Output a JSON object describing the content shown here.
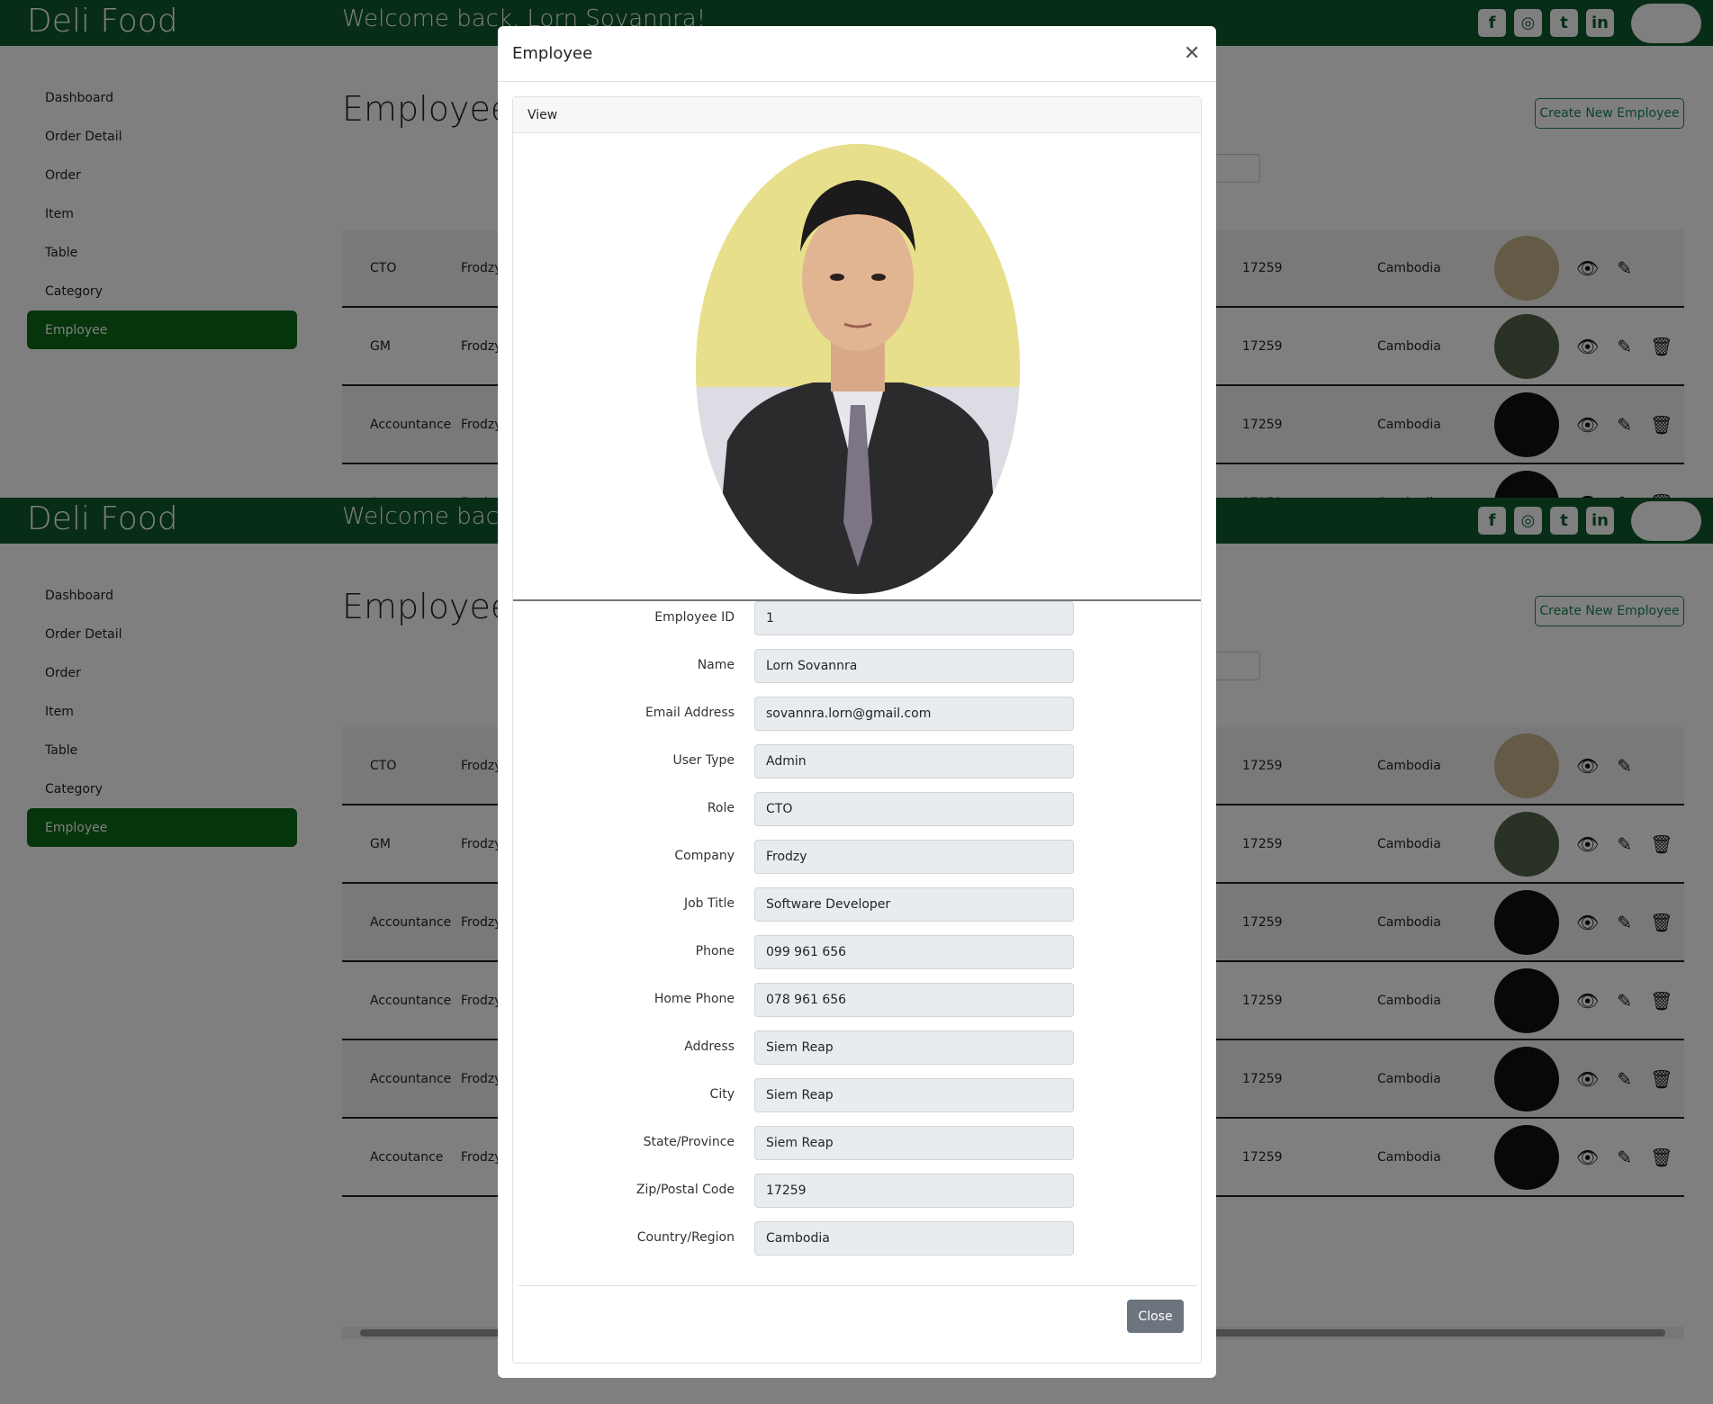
{
  "app": {
    "brand": "Deli Food",
    "welcome": "Welcome back, Lorn Sovannra!",
    "socials": [
      {
        "icon": "facebook-icon",
        "glyph": "f"
      },
      {
        "icon": "instagram-icon",
        "glyph": "◎"
      },
      {
        "icon": "twitter-icon",
        "glyph": "t"
      },
      {
        "icon": "linkedin-icon",
        "glyph": "in"
      }
    ]
  },
  "sidebar": {
    "items": [
      {
        "label": "Dashboard",
        "active": false
      },
      {
        "label": "Order Detail",
        "active": false
      },
      {
        "label": "Order",
        "active": false
      },
      {
        "label": "Item",
        "active": false
      },
      {
        "label": "Table",
        "active": false
      },
      {
        "label": "Category",
        "active": false
      },
      {
        "label": "Employee",
        "active": true
      }
    ]
  },
  "main": {
    "title": "Employee",
    "create_label": "Create New Employee",
    "rows": [
      {
        "role": "CTO",
        "company": "Frodzy",
        "zip": "17259",
        "country": "Cambodia",
        "photo": "photo",
        "delete": false
      },
      {
        "role": "GM",
        "company": "Frodzy",
        "zip": "17259",
        "country": "Cambodia",
        "photo": "photo-olive",
        "delete": true
      },
      {
        "role": "Accountance",
        "company": "Frodzy",
        "zip": "17259",
        "country": "Cambodia",
        "photo": "placeholder",
        "delete": true
      },
      {
        "role": "Accountance",
        "company": "Frodzy",
        "zip": "17259",
        "country": "Cambodia",
        "photo": "placeholder",
        "delete": true
      },
      {
        "role": "Accountance",
        "company": "Frodzy",
        "zip": "17259",
        "country": "Cambodia",
        "photo": "placeholder",
        "delete": true
      },
      {
        "role": "Accoutance",
        "company": "Frodzy",
        "zip": "17259",
        "country": "Cambodia",
        "photo": "placeholder",
        "delete": true
      }
    ]
  },
  "modal": {
    "title": "Employee",
    "card_header": "View",
    "close_label": "Close",
    "fields": [
      {
        "label": "Employee ID",
        "value": "1"
      },
      {
        "label": "Name",
        "value": "Lorn Sovannra"
      },
      {
        "label": "Email Address",
        "value": "sovannra.lorn@gmail.com"
      },
      {
        "label": "User Type",
        "value": "Admin"
      },
      {
        "label": "Role",
        "value": "CTO"
      },
      {
        "label": "Company",
        "value": "Frodzy"
      },
      {
        "label": "Job Title",
        "value": "Software Developer"
      },
      {
        "label": "Phone",
        "value": "099 961 656"
      },
      {
        "label": "Home Phone",
        "value": "078 961 656"
      },
      {
        "label": "Address",
        "value": "Siem Reap"
      },
      {
        "label": "City",
        "value": "Siem Reap"
      },
      {
        "label": "State/Province",
        "value": "Siem Reap"
      },
      {
        "label": "Zip/Postal Code",
        "value": "17259"
      },
      {
        "label": "Country/Region",
        "value": "Cambodia"
      }
    ]
  },
  "colors": {
    "topbar": "#0f5a2c",
    "sidebar_active": "#0d6b18",
    "accent": "#198754",
    "close_button": "#6c757d"
  }
}
